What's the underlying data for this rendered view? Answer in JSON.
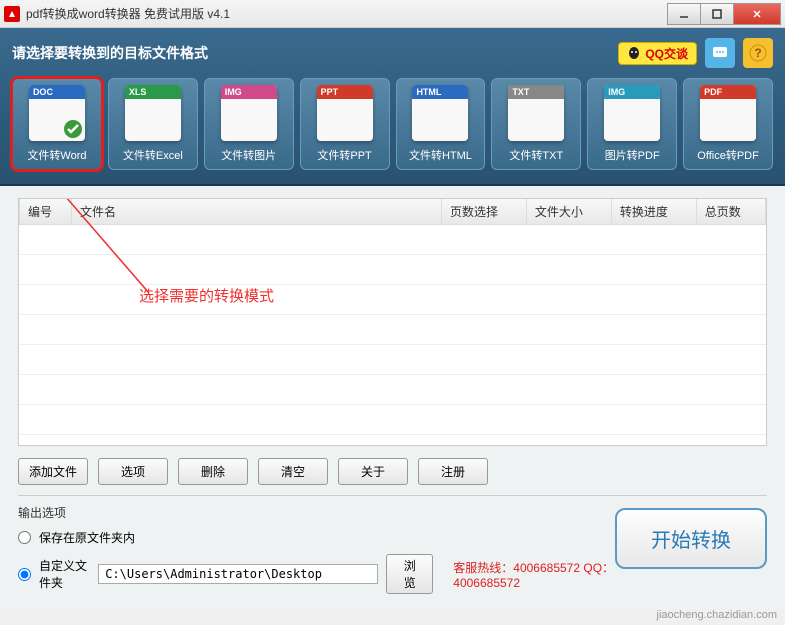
{
  "window": {
    "title": "pdf转换成word转换器 免费试用版 v4.1"
  },
  "header": {
    "instruction": "请选择要转换到的目标文件格式",
    "qq_label": "QQ交谈"
  },
  "formats": [
    {
      "badge": "DOC",
      "badge_color": "#2a6ac0",
      "label": "文件转Word",
      "selected": true,
      "check": true
    },
    {
      "badge": "XLS",
      "badge_color": "#2a9a4a",
      "label": "文件转Excel"
    },
    {
      "badge": "IMG",
      "badge_color": "#d04a8a",
      "label": "文件转图片"
    },
    {
      "badge": "PPT",
      "badge_color": "#d03a2a",
      "label": "文件转PPT"
    },
    {
      "badge": "HTML",
      "badge_color": "#2a6ac0",
      "label": "文件转HTML"
    },
    {
      "badge": "TXT",
      "badge_color": "#888",
      "label": "文件转TXT"
    },
    {
      "badge": "IMG",
      "badge_color": "#2a9aba",
      "label": "图片转PDF"
    },
    {
      "badge": "PDF",
      "badge_color": "#d03a2a",
      "label": "Office转PDF"
    }
  ],
  "columns": {
    "c0": "编号",
    "c1": "文件名",
    "c2": "页数选择",
    "c3": "文件大小",
    "c4": "转换进度",
    "c5": "总页数"
  },
  "annotation": "选择需要的转换模式",
  "actions": {
    "add": "添加文件",
    "options": "选项",
    "delete": "删除",
    "clear": "清空",
    "about": "关于",
    "register": "注册"
  },
  "output": {
    "title": "输出选项",
    "radio_same": "保存在原文件夹内",
    "radio_custom": "自定义文件夹",
    "path": "C:\\Users\\Administrator\\Desktop",
    "browse": "浏览",
    "start": "开始转换",
    "hotline": "客服热线：4006685572 QQ：4006685572"
  },
  "watermark": "jiaocheng.chazidian.com"
}
